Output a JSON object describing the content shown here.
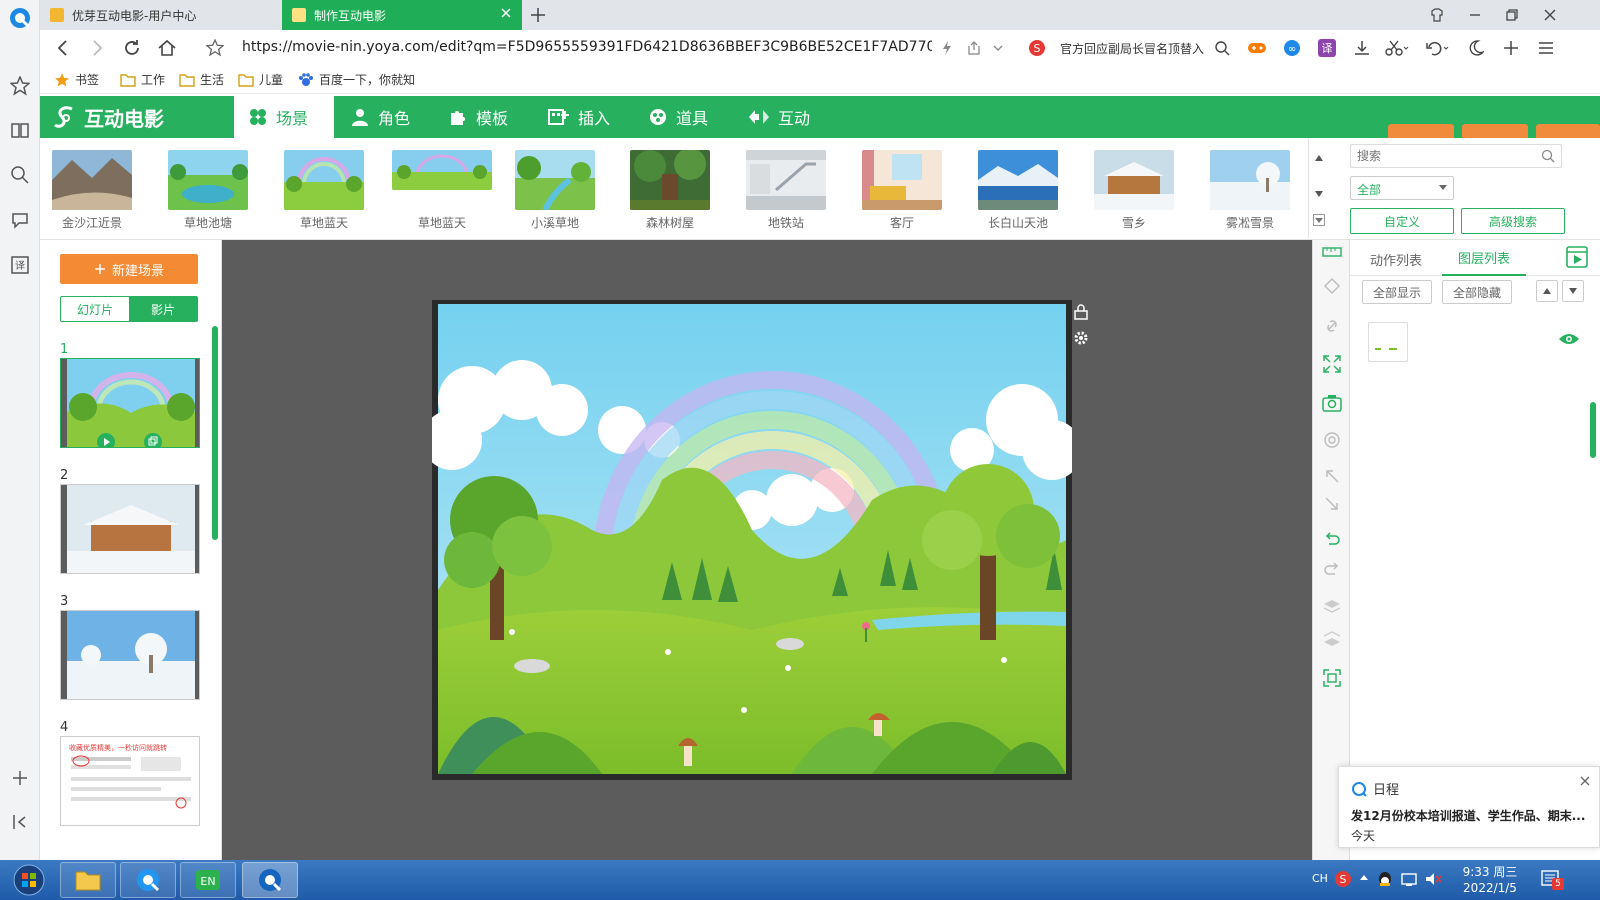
{
  "browser": {
    "tabs": [
      {
        "title": "优芽互动电影-用户中心",
        "active": false
      },
      {
        "title": "制作互动电影",
        "active": true
      }
    ],
    "url": "https://movie-nin.yoya.com/edit?qm=F5D9655559391FD6421D8636BBEF3C9B6BE52CE1F7AD770FF8C81",
    "news_text": "官方回应副局长冒名顶替入",
    "bookmarks": [
      "书签",
      "工作",
      "生活",
      "儿童",
      "百度一下，你就知"
    ]
  },
  "app": {
    "logo_text": "互动电影",
    "nav_tabs": [
      "场景",
      "角色",
      "模板",
      "插入",
      "道具",
      "互动"
    ],
    "active_tab": "场景",
    "accent_color": "#27b15f",
    "scenes": [
      "金沙江近景",
      "草地池塘",
      "草地蓝天",
      "草地蓝天",
      "小溪草地",
      "森林树屋",
      "地铁站",
      "客厅",
      "长白山天池",
      "雪乡",
      "雾凇雪景"
    ],
    "search_placeholder": "搜索",
    "filter_selected": "全部",
    "custom_button": "自定义",
    "advanced_search_button": "高级搜索",
    "new_scene_button": "新建场景",
    "mode_toggle": [
      "幻灯片",
      "影片"
    ],
    "mode_active": "影片",
    "slide_numbers": [
      "1",
      "2",
      "3",
      "4"
    ],
    "slide4_caption": "收藏优质精美，一秒访问就跳转",
    "right_tabs": [
      "动作列表",
      "图层列表"
    ],
    "right_active": "图层列表",
    "show_all_button": "全部显示",
    "hide_all_button": "全部隐藏"
  },
  "notification": {
    "title": "日程",
    "body": "发12月份校本培训报道、学生作品、期末...",
    "when": "今天"
  },
  "taskbar": {
    "ime": "CH",
    "time": "9:33 周三",
    "date": "2022/1/5",
    "badge": "5"
  }
}
